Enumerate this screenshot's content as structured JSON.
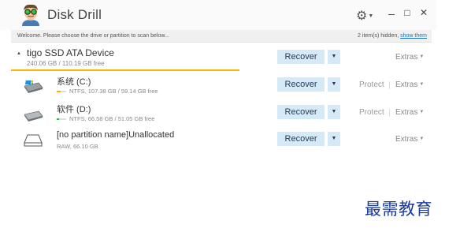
{
  "app": {
    "title": "Disk Drill"
  },
  "window": {
    "minimize": "–",
    "maximize": "□",
    "close": "✕"
  },
  "infobar": {
    "message": "Welcome. Please choose the drive or partition to scan below...",
    "hidden_count": "2 item(s) hidden,",
    "show_link": "show them"
  },
  "device": {
    "name": "tigo SSD ATA Device",
    "size": "240.06 GB / 110.19 GB free",
    "recover_label": "Recover",
    "extras_label": "Extras"
  },
  "partitions": [
    {
      "name": "系统 (C:)",
      "info": "NTFS, 107.38 GB / 59.14 GB free",
      "used_fraction": 0.45,
      "used_color": "#f5b400",
      "recover_label": "Recover",
      "protect_label": "Protect",
      "extras_label": "Extras"
    },
    {
      "name": "软件 (D:)",
      "info": "NTFS, 66.58 GB / 51.05 GB free",
      "used_fraction": 0.23,
      "used_color": "#33b64a",
      "recover_label": "Recover",
      "protect_label": "Protect",
      "extras_label": "Extras"
    },
    {
      "name": "[no partition name]Unallocated",
      "info": "RAW, 66.10 GB",
      "recover_label": "Recover",
      "extras_label": "Extras"
    }
  ],
  "watermark": "最需教育",
  "colors": {
    "accent": "#f5b400",
    "button_bg": "#d6e9f7",
    "link": "#1e73be",
    "watermark": "#1b3a9e"
  }
}
